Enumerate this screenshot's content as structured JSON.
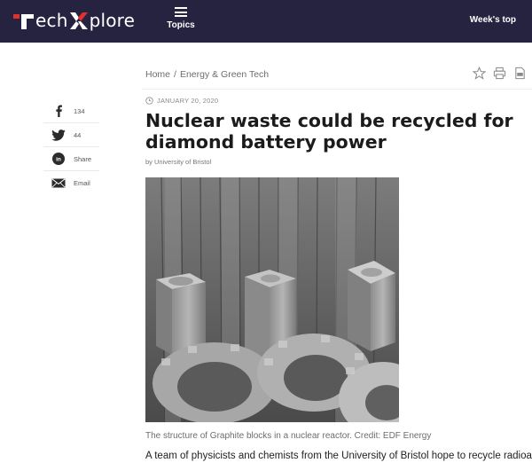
{
  "header": {
    "logo_text_1": "ech",
    "logo_text_2": "plore",
    "topics_label": "Topics",
    "weeks_top_label": "Week's top"
  },
  "breadcrumb": {
    "home": "Home",
    "separator": "/",
    "category": "Energy & Green Tech"
  },
  "toolbar": {
    "icons": [
      "star-icon",
      "print-icon",
      "pdf-icon"
    ]
  },
  "share": [
    {
      "name": "facebook",
      "label": "134",
      "icon": "facebook-icon"
    },
    {
      "name": "twitter",
      "label": "44",
      "icon": "twitter-icon"
    },
    {
      "name": "linkedin",
      "label": "Share",
      "icon": "linkedin-icon"
    },
    {
      "name": "email",
      "label": "Email",
      "icon": "email-icon"
    }
  ],
  "article": {
    "date": "JANUARY 20, 2020",
    "title": "Nuclear waste could be recycled for diamond battery power",
    "byline_prefix": "by",
    "byline_source": "University of Bristol",
    "image_caption": "The structure of Graphite blocks in a nuclear reactor. Credit: EDF Energy",
    "lead_text": "A team of physicists and chemists from the University of Bristol hope to recycle radioactive"
  },
  "colors": {
    "header_bg": "#262340",
    "logo_accent": "#e0312c",
    "text": "#1b1b1b",
    "muted": "#6d6d6d"
  }
}
